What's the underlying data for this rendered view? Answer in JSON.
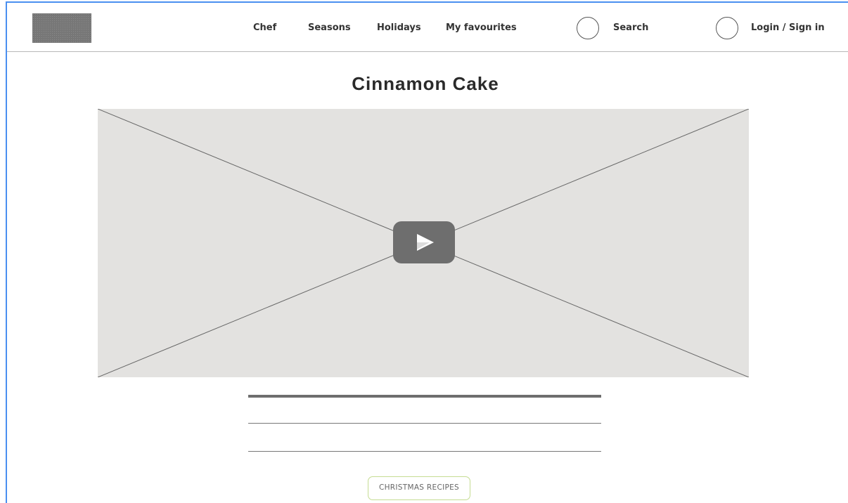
{
  "nav": {
    "items": [
      {
        "label": "Chef"
      },
      {
        "label": "Seasons"
      },
      {
        "label": "Holidays"
      },
      {
        "label": "My favourites"
      }
    ],
    "search_label": "Search",
    "login_label": "Login / Sign in"
  },
  "recipe": {
    "title": "Cinnamon Cake",
    "tag_label": "CHRISTMAS RECIPES"
  },
  "icons": {
    "play": "play-icon",
    "search": "search-icon",
    "user": "user-icon"
  },
  "colors": {
    "frame_accent": "#4a8ff0",
    "placeholder_bg": "#e3e2e0",
    "play_button": "#6e6e6e",
    "tag_border": "#c5dc92"
  }
}
